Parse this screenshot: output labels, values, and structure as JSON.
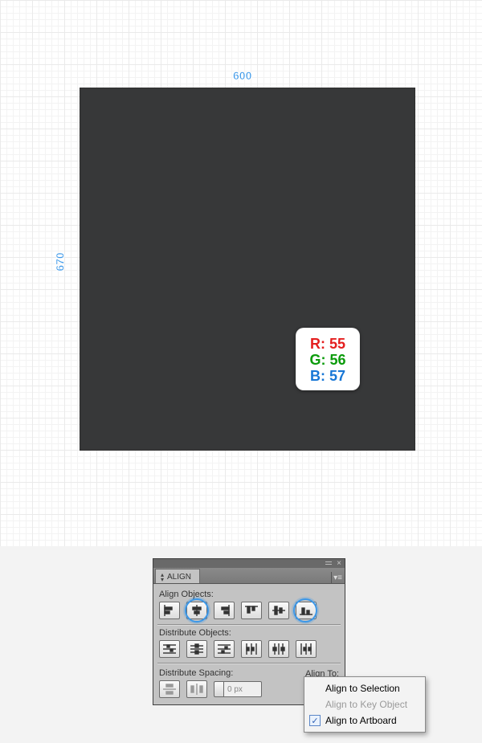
{
  "canvas": {
    "width_label": "600",
    "height_label": "670"
  },
  "rgb": {
    "r_label": "R: 55",
    "g_label": "G: 56",
    "b_label": "B: 57"
  },
  "panel": {
    "title": "ALIGN",
    "align_objects_label": "Align Objects:",
    "distribute_objects_label": "Distribute Objects:",
    "distribute_spacing_label": "Distribute Spacing:",
    "align_to_label": "Align To:",
    "spacing_value": "0 px"
  },
  "flyout": {
    "opt_selection": "Align to Selection",
    "opt_key_object": "Align to Key Object",
    "opt_artboard": "Align to Artboard"
  }
}
